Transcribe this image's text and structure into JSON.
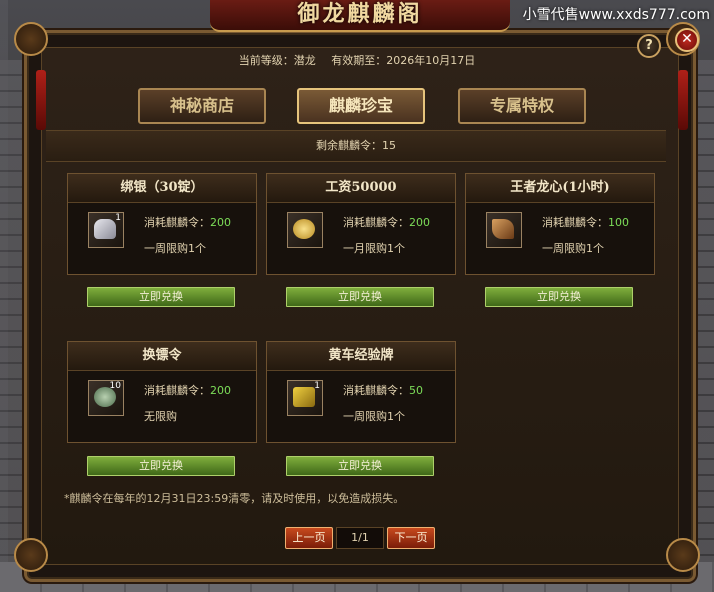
{
  "watermark": "小雪代售www.xxds777.com",
  "window_title": "御龙麒麟阁",
  "header": {
    "level_label": "当前等级：潜龙",
    "expire_label": "有效期至：2026年10月17日"
  },
  "tabs": [
    {
      "label": "神秘商店",
      "active": false
    },
    {
      "label": "麒麟珍宝",
      "active": true
    },
    {
      "label": "专属特权",
      "active": false
    }
  ],
  "remaining": "剩余麒麟令：15",
  "cost_prefix": "消耗麒麟令：",
  "items": [
    {
      "name": "绑银（30锭）",
      "qty": "1",
      "cost": "200",
      "limit": "一周限购1个",
      "icon": "silver-ingot-icon",
      "button": "立即兑换"
    },
    {
      "name": "工资50000",
      "qty": "",
      "cost": "200",
      "limit": "一月限购1个",
      "icon": "gold-coins-icon",
      "button": "立即兑换"
    },
    {
      "name": "王者龙心(1小时)",
      "qty": "",
      "cost": "100",
      "limit": "一周限购1个",
      "icon": "dragon-heart-icon",
      "button": "立即兑换"
    },
    {
      "name": "换镖令",
      "qty": "10",
      "cost": "200",
      "limit": "无限购",
      "icon": "escort-token-icon",
      "button": "立即兑换"
    },
    {
      "name": "黄车经验牌",
      "qty": "1",
      "cost": "50",
      "limit": "一周限购1个",
      "icon": "yellow-cart-icon",
      "button": "立即兑换"
    }
  ],
  "footnote": "*麒麟令在每年的12月31日23:59清零，请及时使用，以免造成损失。",
  "pagination": {
    "prev": "上一页",
    "page": "1/1",
    "next": "下一页"
  },
  "help_symbol": "?",
  "close_symbol": "✕"
}
